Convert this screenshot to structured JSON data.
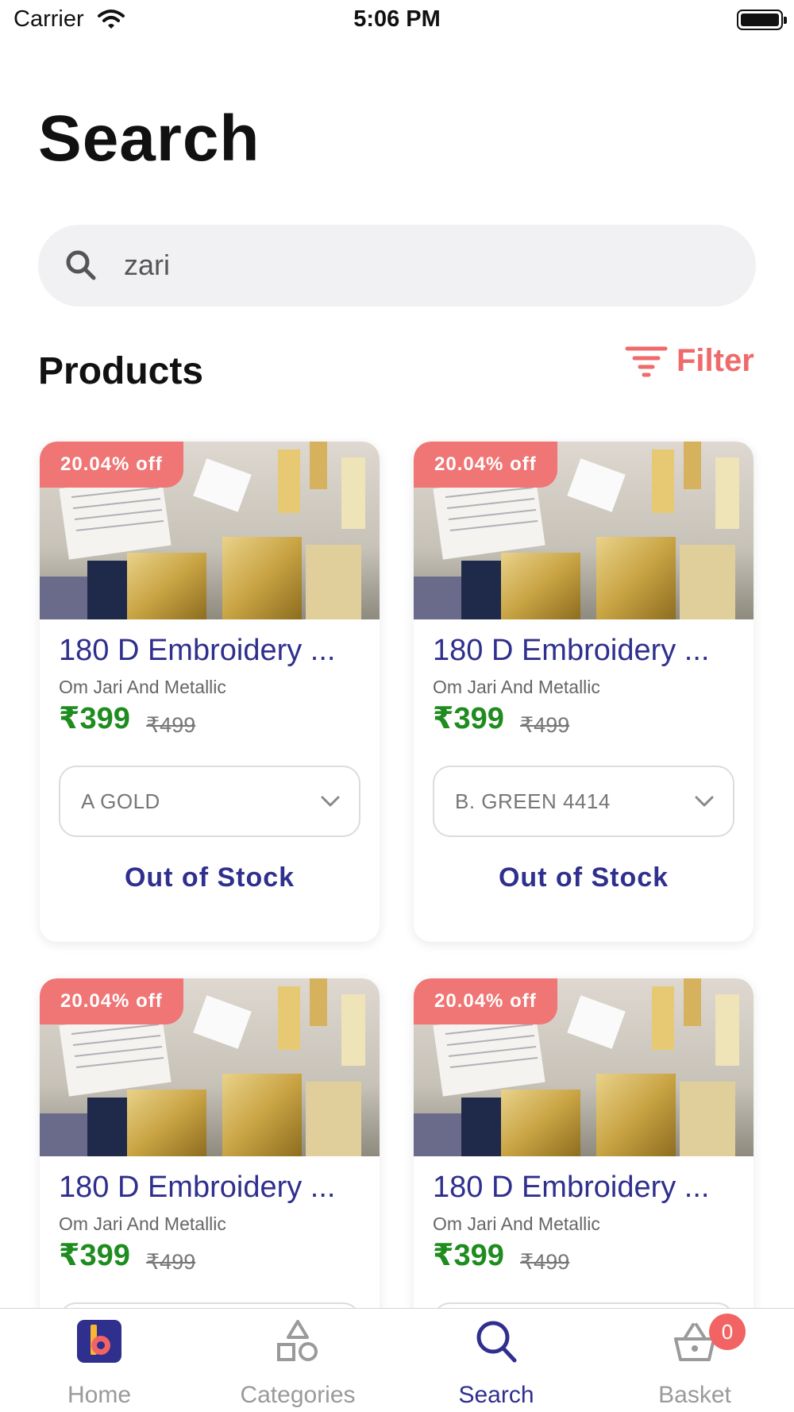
{
  "status_bar": {
    "carrier": "Carrier",
    "time": "5:06 PM"
  },
  "page": {
    "title": "Search"
  },
  "search": {
    "value": "zari",
    "icon": "search-icon"
  },
  "products_section": {
    "title": "Products",
    "filter_label": "Filter",
    "filter_icon": "filter-icon"
  },
  "products": [
    {
      "discount": "20.04% off",
      "name": "180 D Embroidery ...",
      "seller": "Om Jari And Metallic",
      "price": "₹399",
      "mrp": "₹499",
      "variant": "A GOLD",
      "stock": "Out of Stock"
    },
    {
      "discount": "20.04% off",
      "name": "180 D Embroidery ...",
      "seller": "Om Jari And Metallic",
      "price": "₹399",
      "mrp": "₹499",
      "variant": "B. GREEN 4414",
      "stock": "Out of Stock"
    },
    {
      "discount": "20.04% off",
      "name": "180 D Embroidery ...",
      "seller": "Om Jari And Metallic",
      "price": "₹399",
      "mrp": "₹499"
    },
    {
      "discount": "20.04% off",
      "name": "180 D Embroidery ...",
      "seller": "Om Jari And Metallic",
      "price": "₹399",
      "mrp": "₹499"
    }
  ],
  "tabs": [
    {
      "label": "Home",
      "icon": "home-logo-icon"
    },
    {
      "label": "Categories",
      "icon": "categories-icon"
    },
    {
      "label": "Search",
      "icon": "search-icon"
    },
    {
      "label": "Basket",
      "icon": "basket-icon",
      "badge": "0"
    }
  ],
  "colors": {
    "accent": "#2f2f8e",
    "discount": "#f07575",
    "price": "#1f8c1f",
    "filter": "#ef6a6a",
    "badge": "#f26464"
  }
}
